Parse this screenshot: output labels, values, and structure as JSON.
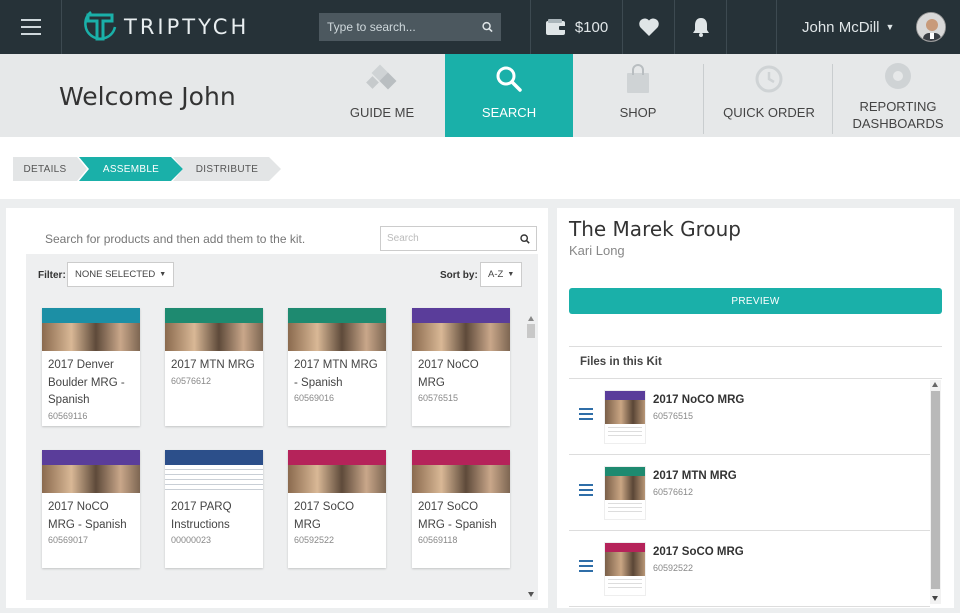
{
  "app": {
    "name": "TRIPTYCH",
    "search_placeholder": "Type to search...",
    "wallet_amount": "$100",
    "user_name": "John McDill"
  },
  "nav": {
    "welcome": "Welcome John",
    "tabs": [
      {
        "label": "GUIDE ME",
        "icon": "diamonds-icon",
        "active": false
      },
      {
        "label": "SEARCH",
        "icon": "magnifier-icon",
        "active": true
      },
      {
        "label": "SHOP",
        "icon": "shopping-bag-icon",
        "active": false
      },
      {
        "label": "QUICK ORDER",
        "icon": "clock-icon",
        "active": false
      },
      {
        "label_line1": "REPORTING",
        "label_line2": "DASHBOARDS",
        "icon": "dashboard-icon",
        "active": false
      }
    ]
  },
  "steps": [
    {
      "label": "DETAILS",
      "state": "done"
    },
    {
      "label": "ASSEMBLE",
      "state": "current"
    },
    {
      "label": "DISTRIBUTE",
      "state": "todo"
    }
  ],
  "products": {
    "hint": "Search for products and then add them to the kit.",
    "search_placeholder": "Search",
    "filter_label": "Filter:",
    "filter_value": "NONE SELECTED",
    "sort_label": "Sort by:",
    "sort_value": "A-Z",
    "items": [
      {
        "l1": "2017 Denver",
        "l2": "Boulder MRG -",
        "l3": "Spanish",
        "code": "60569116",
        "color": "#1c8fa5"
      },
      {
        "l1": "2017 MTN MRG",
        "l2": "",
        "l3": "",
        "code": "60576612",
        "color": "#1e8a70"
      },
      {
        "l1": "2017 MTN MRG",
        "l2": "- Spanish",
        "l3": "",
        "code": "60569016",
        "color": "#1e8a70"
      },
      {
        "l1": "2017 NoCO",
        "l2": "MRG",
        "l3": "",
        "code": "60576515",
        "color": "#5a3d9a"
      },
      {
        "l1": "2017 NoCO",
        "l2": "MRG - Spanish",
        "l3": "",
        "code": "60569017",
        "color": "#5a3d9a"
      },
      {
        "l1": "2017 PARQ",
        "l2": "Instructions",
        "l3": "",
        "code": "00000023",
        "color": "#2c4f8a"
      },
      {
        "l1": "2017 SoCO",
        "l2": "MRG",
        "l3": "",
        "code": "60592522",
        "color": "#b5235a"
      },
      {
        "l1": "2017 SoCO",
        "l2": "MRG - Spanish",
        "l3": "",
        "code": "60569118",
        "color": "#b5235a"
      }
    ]
  },
  "kit": {
    "company": "The Marek Group",
    "contact": "Kari Long",
    "preview_label": "PREVIEW",
    "files_heading": "Files in this Kit",
    "files": [
      {
        "title": "2017 NoCO MRG",
        "code": "60576515",
        "color": "#5a3d9a"
      },
      {
        "title": "2017 MTN MRG",
        "code": "60576612",
        "color": "#1e8a70"
      },
      {
        "title": "2017 SoCO MRG",
        "code": "60592522",
        "color": "#b5235a"
      }
    ]
  }
}
